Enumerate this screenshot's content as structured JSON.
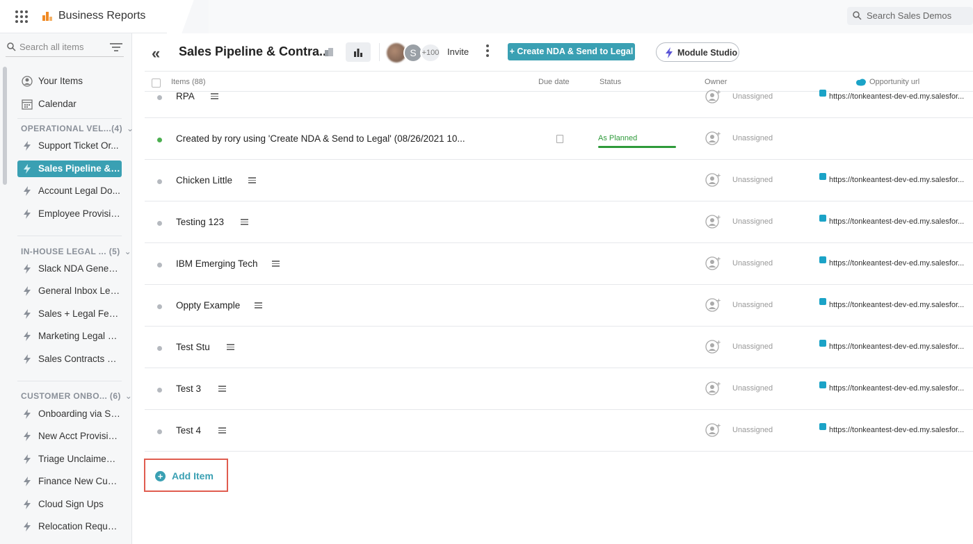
{
  "app": {
    "title": "Business Reports"
  },
  "topbar": {
    "search_placeholder": "Search Sales Demos"
  },
  "sidebar": {
    "search_placeholder": "Search all items",
    "top_items": [
      {
        "label": "Your Items",
        "icon": "user-icon"
      },
      {
        "label": "Calendar",
        "icon": "calendar-icon"
      }
    ],
    "groups": [
      {
        "title": "OPERATIONAL VEL...(4)",
        "items": [
          {
            "label": "Support Ticket Or..."
          },
          {
            "label": "Sales Pipeline & ...",
            "active": true
          },
          {
            "label": "Account Legal Do..."
          },
          {
            "label": "Employee Provisio..."
          }
        ]
      },
      {
        "title": "IN-HOUSE LEGAL ...  (5)",
        "items": [
          {
            "label": "Slack NDA Genera..."
          },
          {
            "label": "General Inbox Leg..."
          },
          {
            "label": "Sales + Legal Fee..."
          },
          {
            "label": "Marketing Legal R..."
          },
          {
            "label": "Sales Contracts & ..."
          }
        ]
      },
      {
        "title": "CUSTOMER ONBO...  (6)",
        "items": [
          {
            "label": "Onboarding via Sl..."
          },
          {
            "label": "New Acct Provisio..."
          },
          {
            "label": "Triage Unclaimed ..."
          },
          {
            "label": "Finance New Cust..."
          },
          {
            "label": "Cloud Sign Ups"
          },
          {
            "label": "Relocation Reque..."
          }
        ]
      }
    ]
  },
  "header": {
    "board_title": "Sales Pipeline & Contra...",
    "avatar_initial": "S",
    "more_count": "+100",
    "invite_label": "Invite",
    "nda_button": "+ Create NDA & Send to Legal",
    "studio_button": "Module Studio"
  },
  "table": {
    "columns": {
      "items": "Items (88)",
      "due": "Due date",
      "status": "Status",
      "owner": "Owner",
      "url": "Opportunity url"
    },
    "rows": [
      {
        "name": "RPA",
        "owner": "Unassigned",
        "url": "https://tonkeantest-dev-ed.my.salesfor..."
      },
      {
        "name": "Created by rory using 'Create NDA & Send to Legal' (08/26/2021 10...",
        "status": "As Planned",
        "owner": "Unassigned",
        "url": ""
      },
      {
        "name": "Chicken Little",
        "owner": "Unassigned",
        "url": "https://tonkeantest-dev-ed.my.salesfor..."
      },
      {
        "name": "Testing 123",
        "owner": "Unassigned",
        "url": "https://tonkeantest-dev-ed.my.salesfor..."
      },
      {
        "name": "IBM Emerging Tech",
        "owner": "Unassigned",
        "url": "https://tonkeantest-dev-ed.my.salesfor..."
      },
      {
        "name": "Oppty Example",
        "owner": "Unassigned",
        "url": "https://tonkeantest-dev-ed.my.salesfor..."
      },
      {
        "name": "Test Stu",
        "owner": "Unassigned",
        "url": "https://tonkeantest-dev-ed.my.salesfor..."
      },
      {
        "name": "Test 3",
        "owner": "Unassigned",
        "url": "https://tonkeantest-dev-ed.my.salesfor..."
      },
      {
        "name": "Test 4",
        "owner": "Unassigned",
        "url": "https://tonkeantest-dev-ed.my.salesfor..."
      }
    ],
    "add_item_label": "Add Item"
  },
  "colors": {
    "accent": "#3aa0b3",
    "status_green": "#2e9a3a",
    "highlight": "#e05c4f"
  }
}
